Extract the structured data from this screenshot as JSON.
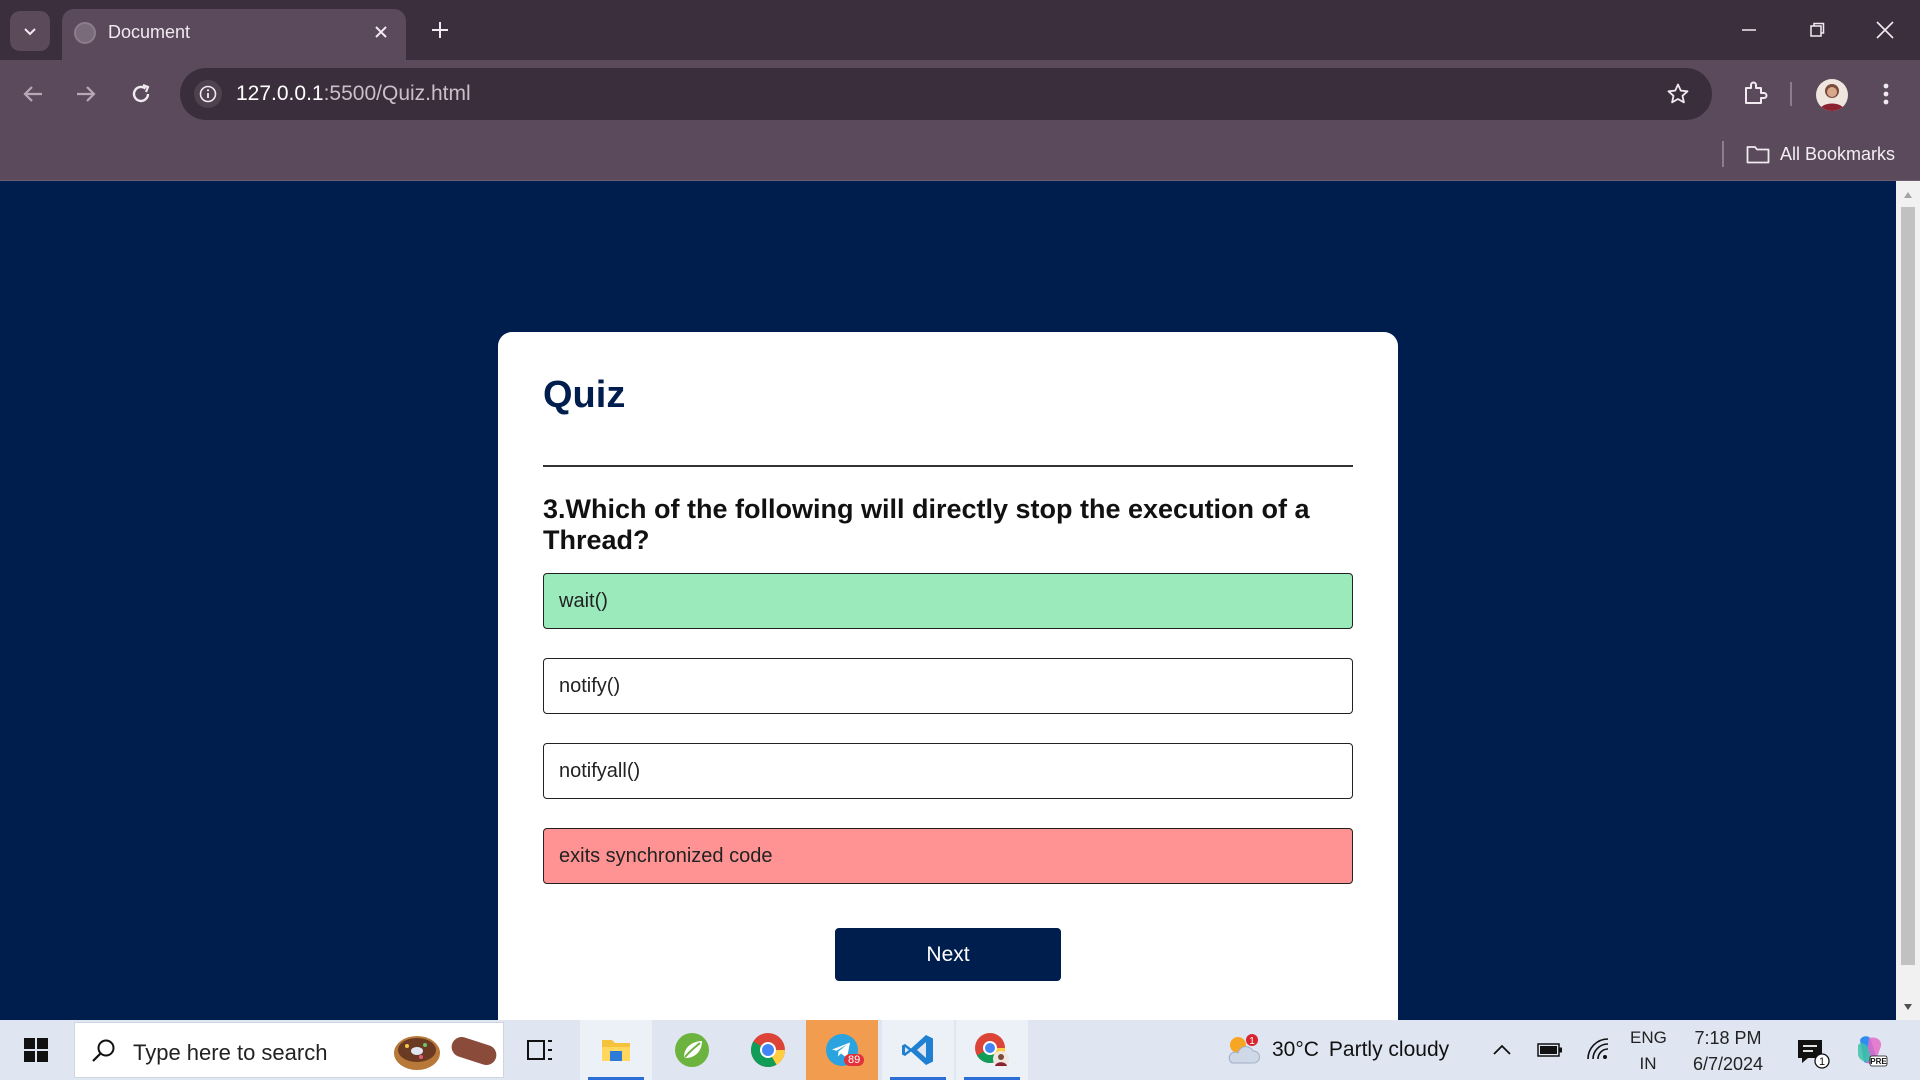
{
  "browser": {
    "tab_title": "Document",
    "url_host": "127.0.0.1",
    "url_path": ":5500/Quiz.html",
    "bookmarks_label": "All Bookmarks"
  },
  "quiz": {
    "title": "Quiz",
    "question": "3.Which of the following will directly stop the execution of a Thread?",
    "answers": [
      {
        "label": "wait()",
        "state": "correct"
      },
      {
        "label": "notify()",
        "state": "neutral"
      },
      {
        "label": "notifyall()",
        "state": "neutral"
      },
      {
        "label": "exits synchronized code",
        "state": "incorrect"
      }
    ],
    "next_label": "Next",
    "colors": {
      "background": "#001e4d",
      "correct": "#9aeabc",
      "incorrect": "#ff9393"
    }
  },
  "taskbar": {
    "search_placeholder": "Type here to search",
    "weather_temp": "30°C",
    "weather_desc": "Partly cloudy",
    "weather_badge": "1",
    "telegram_badge": "89",
    "lang_top": "ENG",
    "lang_bottom": "IN",
    "time": "7:18 PM",
    "date": "6/7/2024",
    "notification_count": "1"
  }
}
